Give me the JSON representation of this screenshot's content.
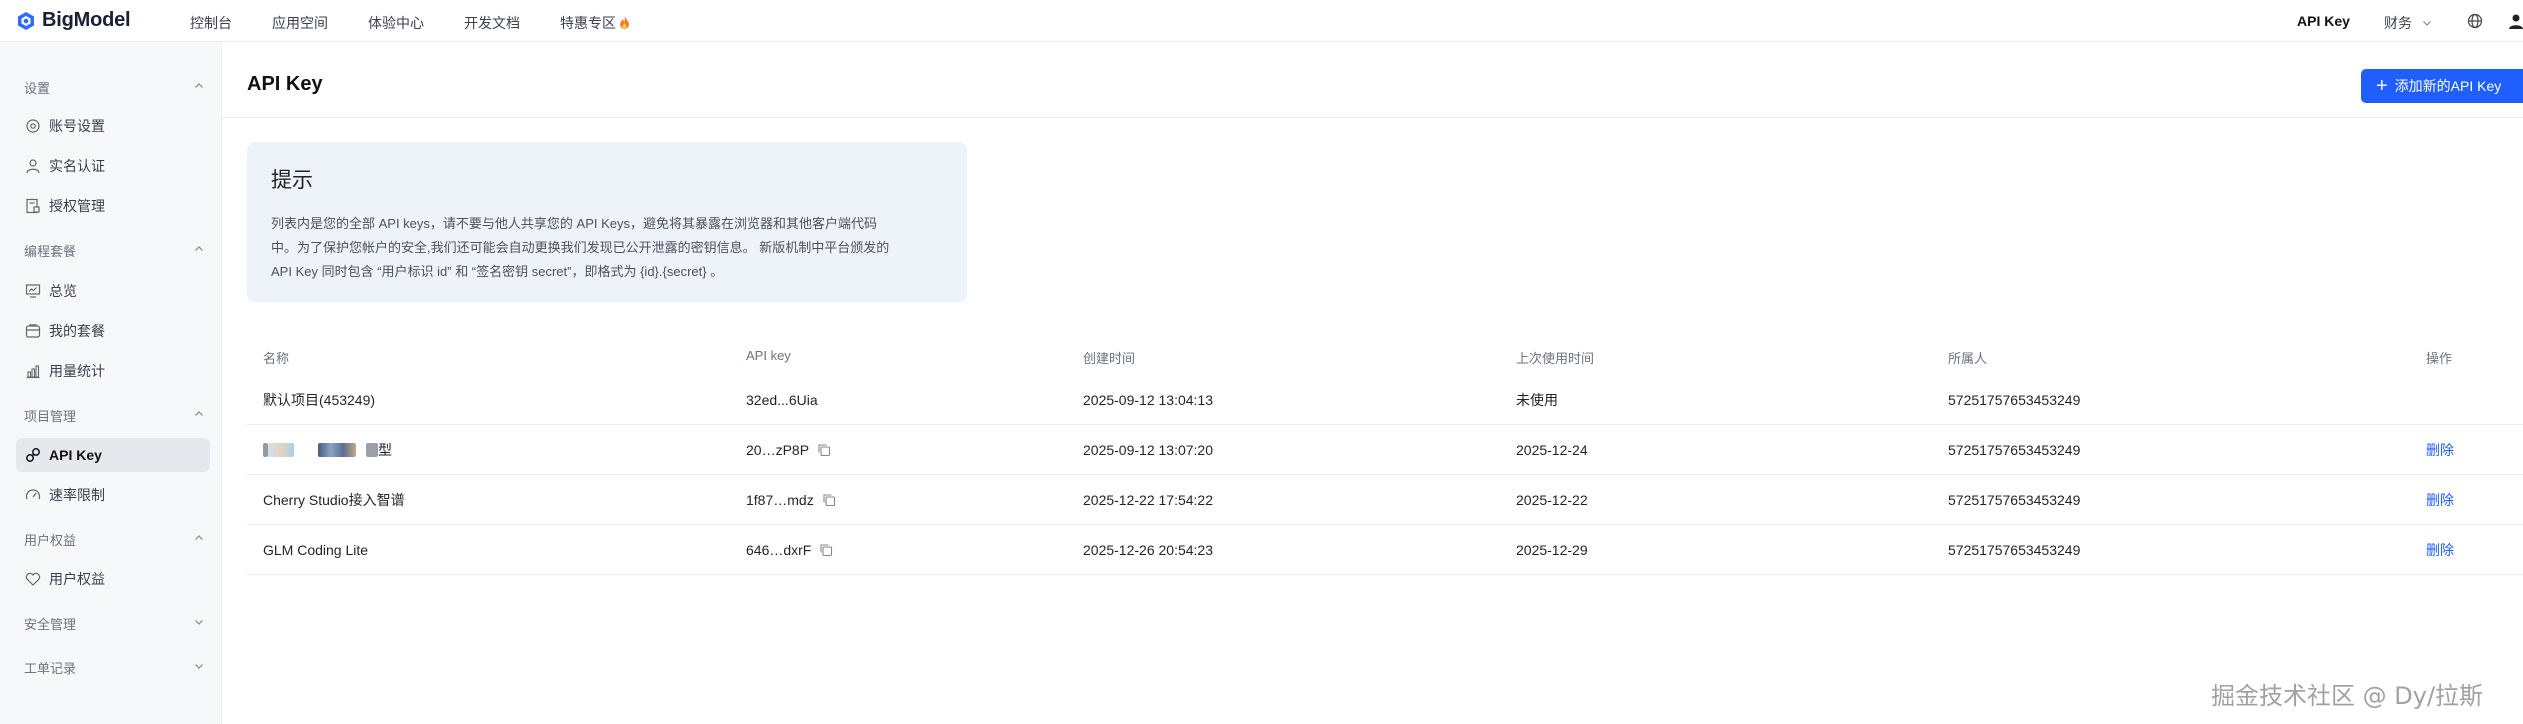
{
  "brand": {
    "name": "BigModel"
  },
  "topnav": {
    "items": [
      "控制台",
      "应用空间",
      "体验中心",
      "开发文档",
      "特惠专区"
    ],
    "right_active": "API Key",
    "finance": "财务"
  },
  "sidebar": {
    "groups": [
      {
        "label": "设置",
        "items": [
          "账号设置",
          "实名认证",
          "授权管理"
        ]
      },
      {
        "label": "编程套餐",
        "items": [
          "总览",
          "我的套餐",
          "用量统计"
        ]
      },
      {
        "label": "项目管理",
        "items": [
          "API Key",
          "速率限制"
        ]
      },
      {
        "label": "用户权益",
        "items": [
          "用户权益"
        ]
      },
      {
        "label": "安全管理",
        "items": []
      },
      {
        "label": "工单记录",
        "items": []
      }
    ]
  },
  "page": {
    "title": "API Key",
    "add_button": "添加新的API Key"
  },
  "tip": {
    "title": "提示",
    "lines": [
      "列表内是您的全部 API keys，请不要与他人共享您的 API Keys，避免将其暴露在浏览器和其他客户端代码",
      "中。为了保护您帐户的安全,我们还可能会自动更换我们发现已公开泄露的密钥信息。 新版机制中平台颁发的",
      "API Key 同时包含 “用户标识 id” 和 “签名密钥 secret”，即格式为 {id}.{secret} 。"
    ]
  },
  "table": {
    "headers": [
      "名称",
      "API key",
      "创建时间",
      "上次使用时间",
      "所属人",
      "操作"
    ],
    "rows": [
      {
        "name": "默认项目(453249)",
        "key": "32ed...6Uia",
        "created": "2025-09-12 13:04:13",
        "last_used": "未使用",
        "owner": "57251757653453249",
        "action": ""
      },
      {
        "name": "型",
        "key": "20…zP8P",
        "created": "2025-09-12 13:07:20",
        "last_used": "2025-12-24",
        "owner": "57251757653453249",
        "action": "删除"
      },
      {
        "name": "Cherry Studio接入智谱",
        "key": "1f87…mdz",
        "created": "2025-12-22 17:54:22",
        "last_used": "2025-12-22",
        "owner": "57251757653453249",
        "action": "删除"
      },
      {
        "name": "GLM Coding Lite",
        "key": "646…dxrF",
        "created": "2025-12-26 20:54:23",
        "last_used": "2025-12-29",
        "owner": "57251757653453249",
        "action": "删除"
      }
    ]
  },
  "watermark": "掘金技术社区 @ Dy/拉斯",
  "colors": {
    "accent": "#1f5eff",
    "sidebar_bg": "#f7f8fa",
    "tip_bg": "#eef2f9"
  }
}
